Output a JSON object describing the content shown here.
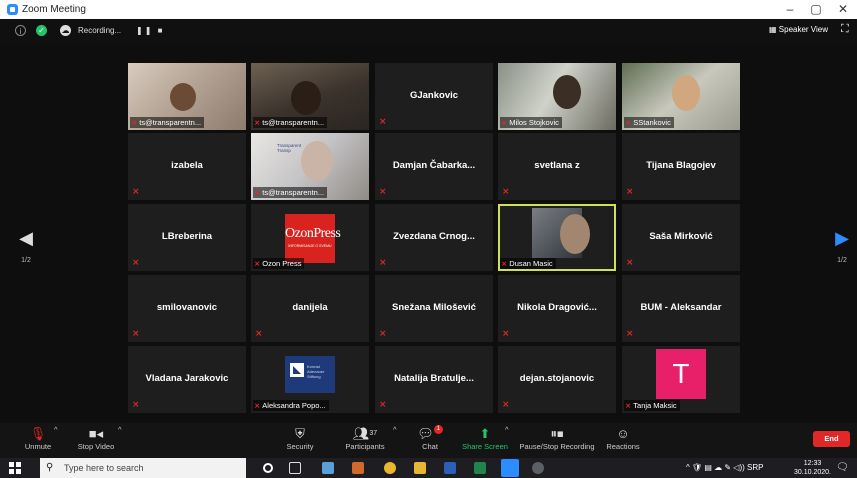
{
  "window": {
    "title": "Zoom Meeting",
    "controls": [
      "–",
      "▢",
      "✕"
    ]
  },
  "topbar": {
    "recording_label": "Recording...",
    "recording_controls": "❚❚ ■",
    "speaker_view_label": "Speaker View"
  },
  "tiles": [
    [
      {
        "name": "",
        "label": "ts@transparentn...",
        "video": "v1"
      },
      {
        "name": "",
        "label": "ts@transparentn...",
        "video": "v2"
      },
      {
        "name": "GJankovic",
        "label": "",
        "video": ""
      },
      {
        "name": "",
        "label": "Milos Stojkovic",
        "video": "v3"
      },
      {
        "name": "",
        "label": "SStankovic",
        "video": "v4"
      }
    ],
    [
      {
        "name": "izabela",
        "label": "",
        "video": ""
      },
      {
        "name": "",
        "label": "ts@transparentn...",
        "video": "v5"
      },
      {
        "name": "Damjan Čabarka...",
        "label": "",
        "video": ""
      },
      {
        "name": "svetlana z",
        "label": "",
        "video": ""
      },
      {
        "name": "Tijana Blagojev",
        "label": "",
        "video": ""
      }
    ],
    [
      {
        "name": "LBreberina",
        "label": "",
        "video": ""
      },
      {
        "name": "",
        "label": "Ozon Press",
        "video": "ozon"
      },
      {
        "name": "Zvezdana Crnog...",
        "label": "",
        "video": ""
      },
      {
        "name": "",
        "label": "Dusan Masic",
        "video": "v6"
      },
      {
        "name": "Saša Mirković",
        "label": "",
        "video": ""
      }
    ],
    [
      {
        "name": "smilovanovic",
        "label": "",
        "video": ""
      },
      {
        "name": "danijela",
        "label": "",
        "video": ""
      },
      {
        "name": "Snežana Milošević",
        "label": "",
        "video": ""
      },
      {
        "name": "Nikola Dragović...",
        "label": "",
        "video": ""
      },
      {
        "name": "BUM - Aleksandar",
        "label": "",
        "video": ""
      }
    ],
    [
      {
        "name": "Vladana Jarakovic",
        "label": "",
        "video": ""
      },
      {
        "name": "",
        "label": "Aleksandra Popo...",
        "video": "kas"
      },
      {
        "name": "Natalija Bratulje...",
        "label": "",
        "video": ""
      },
      {
        "name": "dejan.stojanovic",
        "label": "",
        "video": ""
      },
      {
        "name": "",
        "label": "Tanja Maksic",
        "video": "avatar-t"
      }
    ]
  ],
  "tile_content": {
    "ozon_logo": "OzonPress",
    "ozon_sub": "INFORMISANJE O SVEMU",
    "kas_text": "Konrad Adenauer Stiftung",
    "avatar_letter": "T",
    "transparency_text": "Transparent Transp"
  },
  "active_speaker": "Dusan Masic",
  "pagination": {
    "left": "1/2",
    "right": "1/2"
  },
  "controls": {
    "unmute": "Unmute",
    "stop_video": "Stop Video",
    "security": "Security",
    "participants": "Participants",
    "participants_count": "37",
    "chat": "Chat",
    "chat_badge": "1",
    "share_screen": "Share Screen",
    "pause_recording": "Pause/Stop Recording",
    "reactions": "Reactions",
    "end": "End"
  },
  "colors": {
    "share_screen": "#25c46a",
    "end": "#e02828",
    "active_outline": "#cfe05c",
    "muted_mic": "#e02828"
  },
  "taskbar": {
    "search_placeholder": "Type here to search",
    "tray_lang": "SRP",
    "time": "12:33",
    "date": "30.10.2020."
  }
}
